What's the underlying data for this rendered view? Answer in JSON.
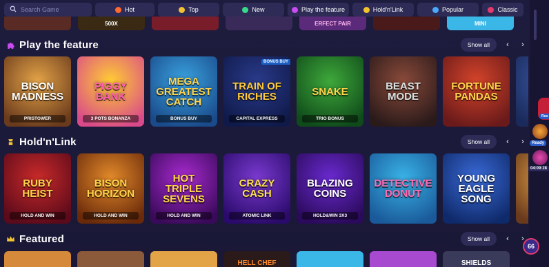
{
  "search": {
    "placeholder": "Search Game"
  },
  "filters": [
    {
      "label": "Hot",
      "icon": "flame-icon",
      "color": "#ff6a2f",
      "width": 86
    },
    {
      "label": "Top",
      "icon": "crown-coin-icon",
      "color": "#f2c230",
      "width": 89
    },
    {
      "label": "New",
      "icon": "new-tag-icon",
      "color": "#39d98a",
      "width": 89
    },
    {
      "label": "Play the feature",
      "icon": "puzzle-icon",
      "color": "#c94cf0",
      "width": 89
    },
    {
      "label": "Hold'n'Link",
      "icon": "link-icon",
      "color": "#f2c230",
      "width": 89
    },
    {
      "label": "Popular",
      "icon": "rocket-icon",
      "color": "#4aa8ff",
      "width": 89
    },
    {
      "label": "Classic",
      "icon": "cherry-icon",
      "color": "#e23b6d",
      "width": 60
    }
  ],
  "top_partial": [
    {
      "text": "",
      "bg": "#5a2a24"
    },
    {
      "text": "500X",
      "bg": "#3a2a14"
    },
    {
      "text": "",
      "bg": "#7a1d2a"
    },
    {
      "text": "",
      "bg": "#3a2a5a"
    },
    {
      "text": "ERFECT PAIR",
      "bg": "#5b2a7a"
    },
    {
      "text": "",
      "bg": "#4a1a1a"
    },
    {
      "text": "MINI",
      "bg": "#3ab7e6"
    }
  ],
  "sections": [
    {
      "title": "Play the feature",
      "icon": "puzzle-icon",
      "icon_color": "#c94cf0",
      "show_all": "Show all",
      "games": [
        {
          "name": "Bison Madness",
          "sub": "PRISTOWER",
          "bg1": "#e3a347",
          "bg2": "#6a3a1c",
          "color": "#fff"
        },
        {
          "name": "Piggy Bank",
          "sub": "3 POTS BONANZA",
          "bg1": "#ffcc33",
          "bg2": "#d94a8a",
          "color": "#ff5fb0"
        },
        {
          "name": "Mega Greatest Catch",
          "sub": "BONUS BUY",
          "bg1": "#3aa3e0",
          "bg2": "#1a4a8a",
          "color": "#ffd34a"
        },
        {
          "name": "Train of Riches",
          "sub": "CAPITAL EXPRESS",
          "bg1": "#2a3a8a",
          "bg2": "#0f1a4a",
          "color": "#ffcb3a",
          "badge": "BONUS BUY"
        },
        {
          "name": "Snake",
          "sub": "TRIO BONUS",
          "bg1": "#3ea83a",
          "bg2": "#0f4a1a",
          "color": "#ffd34a"
        },
        {
          "name": "Beast Mode",
          "sub": "",
          "bg1": "#8a4a3a",
          "bg2": "#2a1a1a",
          "color": "#d8e0e0"
        },
        {
          "name": "Fortune Pandas",
          "sub": "",
          "bg1": "#d4442a",
          "bg2": "#6a1a1a",
          "color": "#ffd34a"
        },
        {
          "name": "",
          "sub": "",
          "bg1": "#3a5aa8",
          "bg2": "#1a2a5a",
          "color": "#fff"
        }
      ]
    },
    {
      "title": "Hold'n'Link",
      "icon": "link-icon",
      "icon_color": "#f2c230",
      "show_all": "Show all",
      "games": [
        {
          "name": "Ruby Heist",
          "sub": "HOLD AND WIN",
          "bg1": "#c92a2a",
          "bg2": "#5a0a1a",
          "color": "#ffd34a"
        },
        {
          "name": "Bison Horizon",
          "sub": "HOLD AND WIN",
          "bg1": "#e38a2a",
          "bg2": "#6a2a0a",
          "color": "#ffd34a"
        },
        {
          "name": "Hot Triple Sevens",
          "sub": "HOLD AND WIN",
          "bg1": "#a82ad0",
          "bg2": "#3a0a5a",
          "color": "#ffd34a"
        },
        {
          "name": "Crazy Cash",
          "sub": "ATOMIC LINK",
          "bg1": "#7a3ad0",
          "bg2": "#2a0a6a",
          "color": "#ffe24a"
        },
        {
          "name": "Blazing Coins",
          "sub": "HOLD&WIN 3X3",
          "bg1": "#6a2ad0",
          "bg2": "#2a0a5a",
          "color": "#fff"
        },
        {
          "name": "Detective Donut",
          "sub": "",
          "bg1": "#39b3e6",
          "bg2": "#1a5a9a",
          "color": "#ff6ab0"
        },
        {
          "name": "Young Eagle Song",
          "sub": "",
          "bg1": "#3a6ad8",
          "bg2": "#0f2a6a",
          "color": "#fff"
        },
        {
          "name": "",
          "sub": "",
          "bg1": "#e3a347",
          "bg2": "#6a3a1c",
          "color": "#fff"
        }
      ]
    },
    {
      "title": "Featured",
      "icon": "crown-icon",
      "icon_color": "#f2c230",
      "show_all": "Show all"
    }
  ],
  "bottom_partial": [
    {
      "text": "",
      "bg": "#d48a3a"
    },
    {
      "text": "",
      "bg": "#8a5a3a"
    },
    {
      "text": "",
      "bg": "#e3a347"
    },
    {
      "text": "HELL CHEF",
      "bg": "#2a1a1a"
    },
    {
      "text": "",
      "bg": "#3ab7e6"
    },
    {
      "text": "",
      "bg": "#a84ad0"
    },
    {
      "text": "SHIELDS",
      "bg": "#3a3a5a"
    }
  ],
  "side": {
    "widget1_label": "Rea",
    "widget2_label": "Ready",
    "timer": "04:09:28",
    "chat_count": "66"
  }
}
